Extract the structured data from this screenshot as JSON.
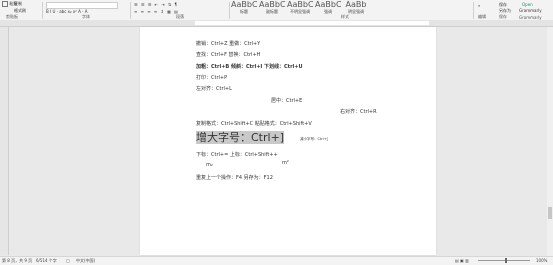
{
  "ribbon": {
    "clipboard": {
      "paste": "粘贴",
      "copy": "复制",
      "format_painter": "格式刷",
      "label": "剪贴板"
    },
    "font": {
      "label": "字体",
      "format_row": "B I U · abc x₂ x² A · A"
    },
    "paragraph": {
      "label": "段落"
    },
    "styles": {
      "label": "样式",
      "items": [
        {
          "big": "AaBbCcDd",
          "name": "标题"
        },
        {
          "big": "AaBbCc",
          "name": "副标题"
        },
        {
          "big": "AaBbCcDd",
          "name": "不明显强调"
        },
        {
          "big": "AaBbCcDd",
          "name": "强调"
        },
        {
          "big": "AaBb",
          "name": "明显强调"
        }
      ]
    },
    "editing": {
      "label": "编辑"
    },
    "save": {
      "line1": "保存",
      "line2": "另存为",
      "label": "保存"
    },
    "grammarly": {
      "line1": "Open",
      "line2": "Grammarly",
      "label": "Grammarly"
    }
  },
  "document": {
    "l1": "撤销：Ctrl+Z   重做：Ctrl+Y",
    "l2": "查找：Ctrl+F   替换：Ctrl+H",
    "l3": "加粗：Ctrl+B   倾斜：Ctrl+I   下划线：Ctrl+U",
    "l4": "打印：Ctrl+P",
    "l5": "左对齐：Ctrl+L",
    "l6": "居中：Ctrl+E",
    "l7": "右对齐：Ctrl+R",
    "l8": "复制格式：Ctrl+Shift+C     粘贴格式：Ctrl+Shift+V",
    "l9_big": "增大字号：Ctrl+]",
    "l9_small": "减小字号：Ctrl+[",
    "l10": "下标：Ctrl+=         上标：Ctrl+Shift++",
    "l11a": "m₂",
    "l11b": "m²",
    "l12": "重复上一个操作：F4        另存为：F12"
  },
  "status": {
    "page": "第 8 页，共 9 页",
    "words": "6/514 个字",
    "language": "中文(中国)",
    "zoom": "100%"
  }
}
